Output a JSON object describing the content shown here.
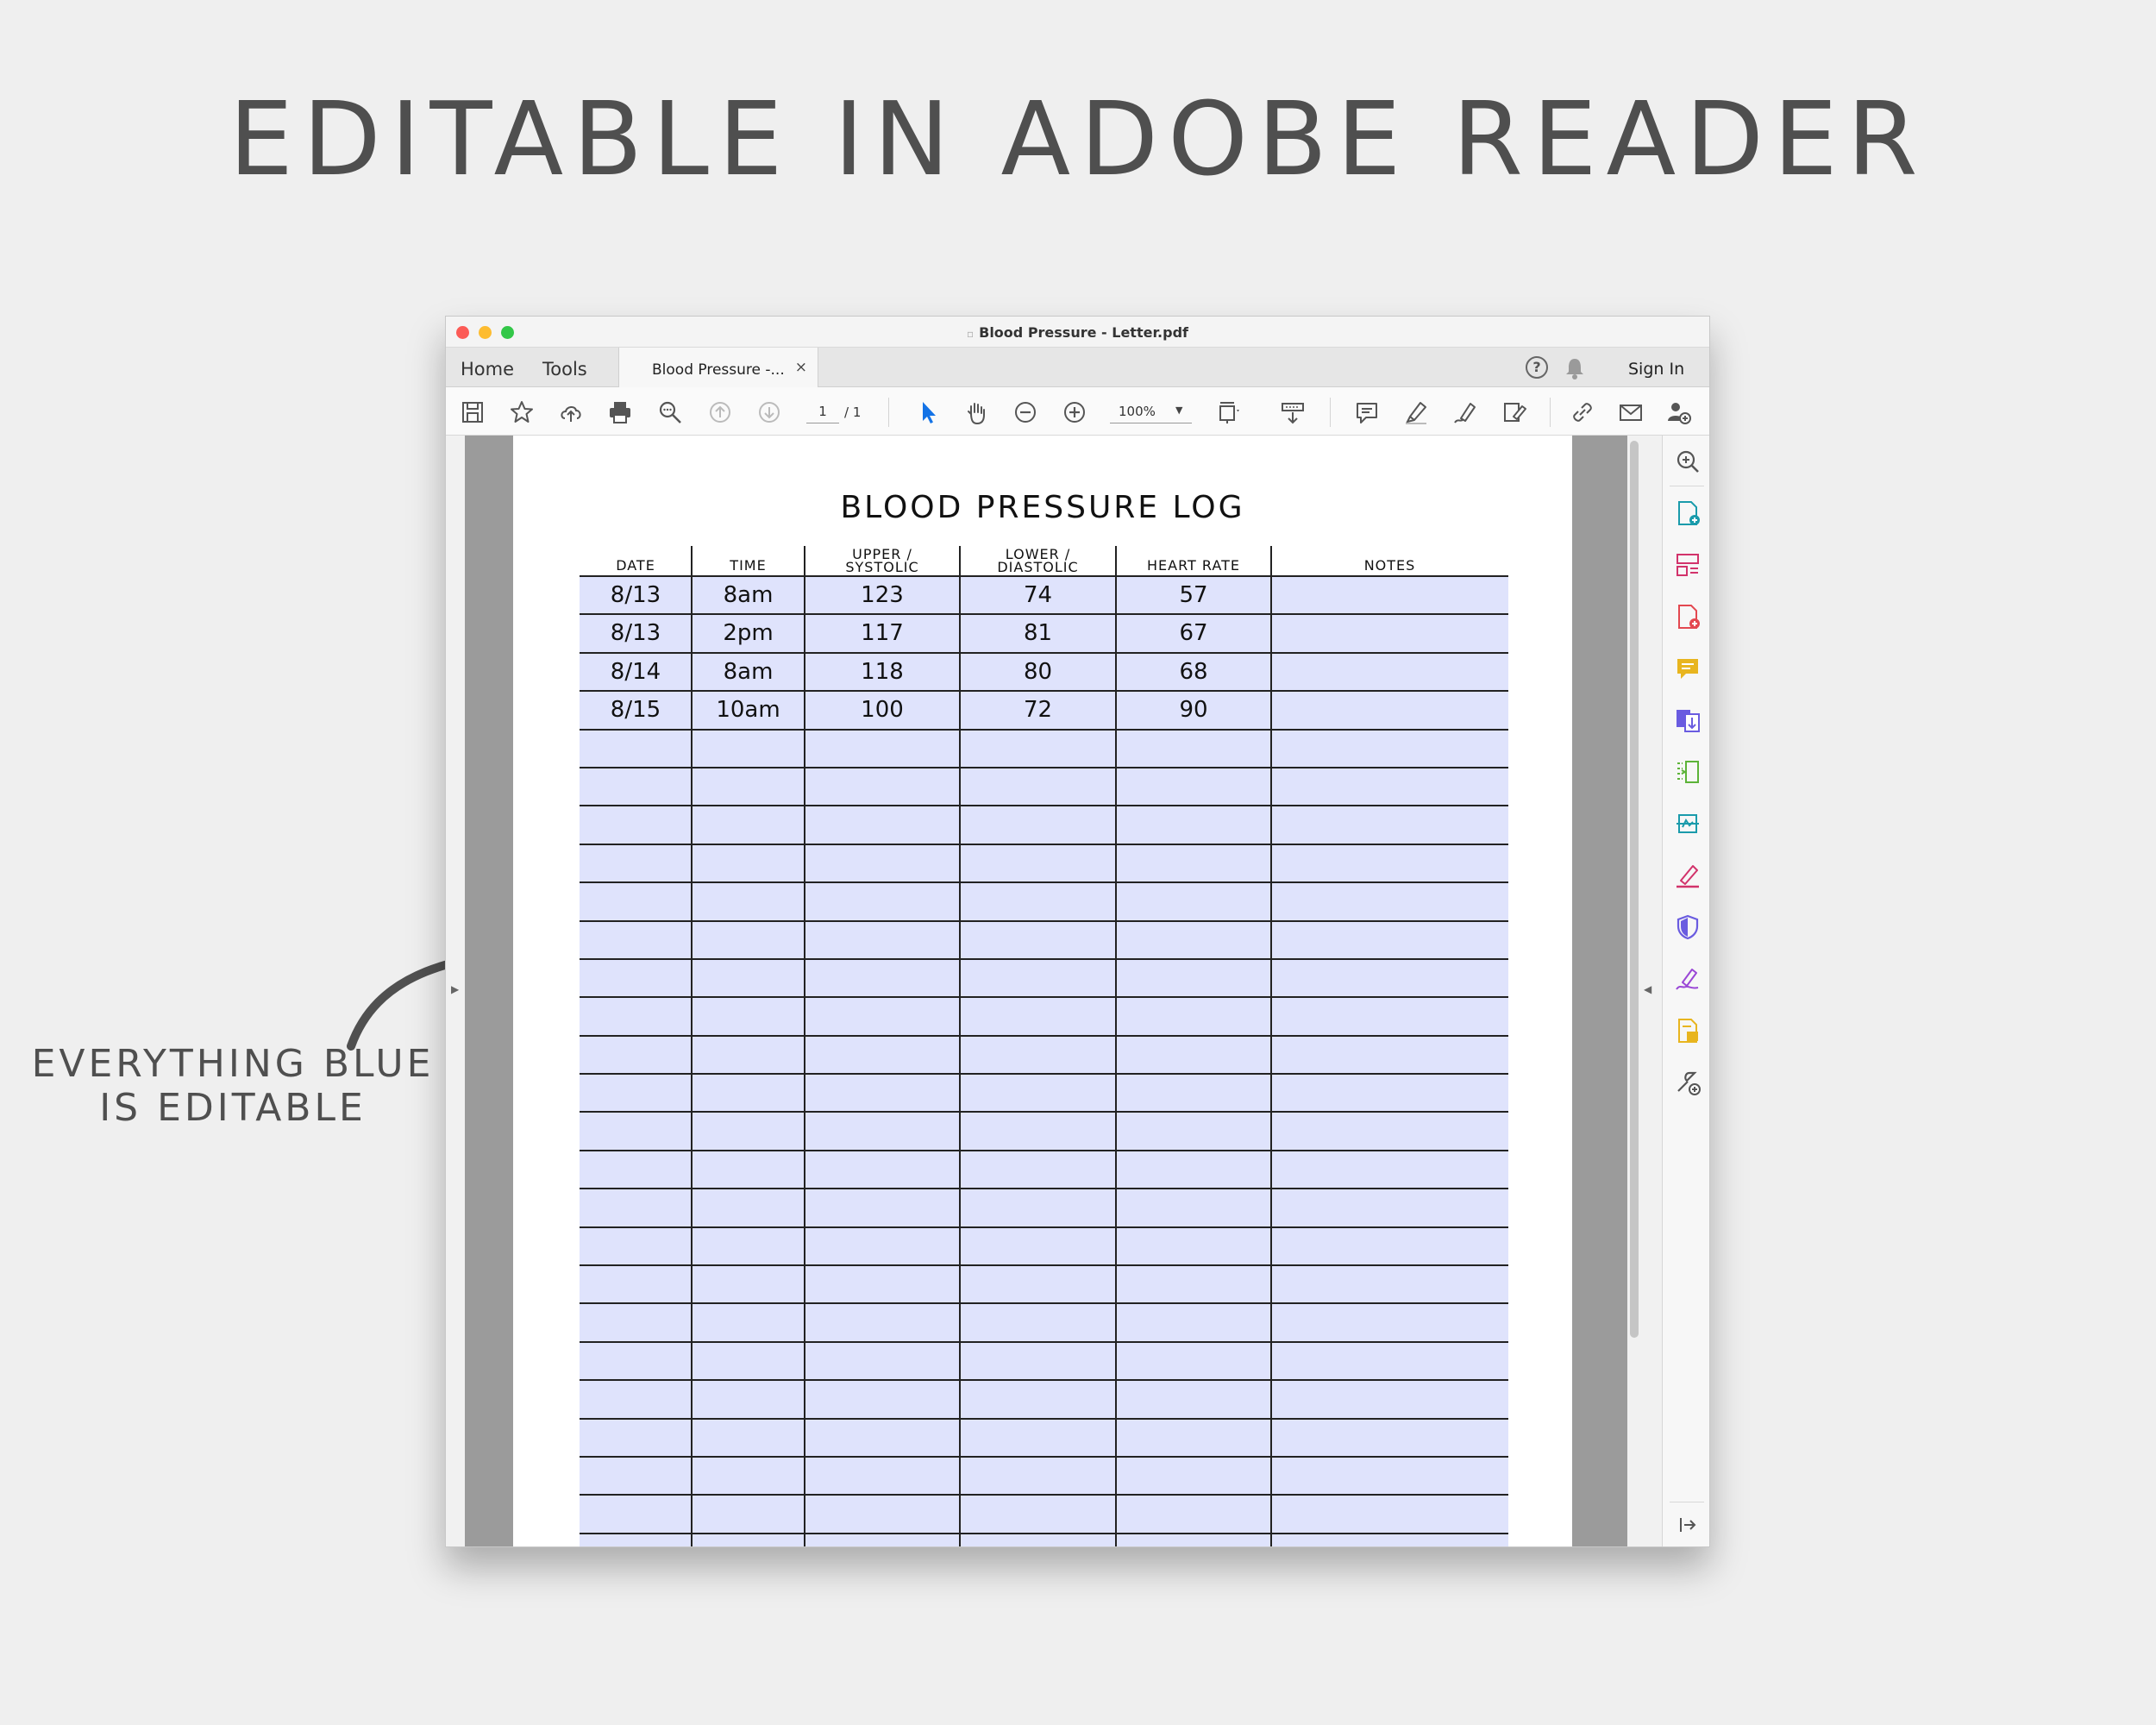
{
  "headline": "EDITABLE IN ADOBE READER",
  "callout": {
    "line1": "EVERYTHING BLUE",
    "line2": "IS EDITABLE"
  },
  "window": {
    "title": "Blood Pressure - Letter.pdf",
    "tabs": {
      "home": "Home",
      "tools": "Tools",
      "document": "Blood Pressure -...",
      "close": "×"
    },
    "sign_in": "Sign In",
    "help": "?"
  },
  "toolbar": {
    "page_current": "1",
    "page_total": "/ 1",
    "zoom": "100%",
    "icons": [
      "save-icon",
      "bookmark-star-icon",
      "upload-cloud-icon",
      "print-icon",
      "search-zoom-icon",
      "previous-page-icon",
      "next-page-icon",
      "select-pointer-icon",
      "hand-tool-icon",
      "zoom-out-icon",
      "zoom-in-icon",
      "fit-page-icon",
      "scroll-mode-icon",
      "comment-icon",
      "highlight-icon",
      "draw-icon",
      "fill-sign-icon",
      "share-link-icon",
      "email-icon",
      "add-user-icon"
    ]
  },
  "document": {
    "title": "BLOOD PRESSURE LOG",
    "columns": [
      {
        "label": "DATE"
      },
      {
        "label": "TIME"
      },
      {
        "label_top": "UPPER /",
        "label_bottom": "SYSTOLIC"
      },
      {
        "label_top": "LOWER /",
        "label_bottom": "DIASTOLIC"
      },
      {
        "label": "HEART RATE"
      },
      {
        "label": "NOTES"
      }
    ],
    "rows": [
      [
        "8/13",
        "8am",
        "123",
        "74",
        "57",
        ""
      ],
      [
        "8/13",
        "2pm",
        "117",
        "81",
        "67",
        ""
      ],
      [
        "8/14",
        "8am",
        "118",
        "80",
        "68",
        ""
      ],
      [
        "8/15",
        "10am",
        "100",
        "72",
        "90",
        ""
      ]
    ],
    "empty_rows": 22
  },
  "colors": {
    "editable_field": "#dfe3fc",
    "background": "#efefef",
    "viewer_gray": "#9b9b9b",
    "select_blue": "#1473e6"
  },
  "side_panel_icons": [
    "zoom-search-icon",
    "create-pdf-icon",
    "organize-pages-icon",
    "edit-pdf-icon",
    "comment-icon",
    "export-pdf-icon",
    "compress-pdf-icon",
    "scan-icon",
    "fill-sign-icon",
    "protect-icon",
    "request-signature-icon",
    "stamp-icon",
    "more-tools-icon",
    "collapse-panel-icon"
  ]
}
